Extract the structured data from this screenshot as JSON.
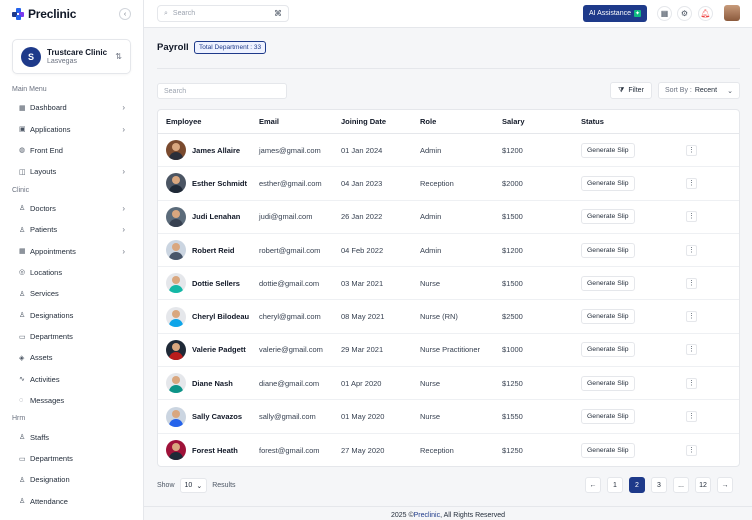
{
  "brand": {
    "name": "Preclinic"
  },
  "clinic": {
    "name": "Trustcare Clinic",
    "location": "Lasvegas",
    "initial": "S"
  },
  "sidebar": {
    "sections": [
      {
        "title": "Main Menu",
        "items": [
          {
            "label": "Dashboard",
            "icon": "grid-icon",
            "chevron": true
          },
          {
            "label": "Applications",
            "icon": "apps-icon",
            "chevron": true
          },
          {
            "label": "Front End",
            "icon": "globe-icon",
            "chevron": false
          },
          {
            "label": "Layouts",
            "icon": "layout-icon",
            "chevron": true
          }
        ]
      },
      {
        "title": "Clinic",
        "items": [
          {
            "label": "Doctors",
            "icon": "doctor-icon",
            "chevron": true
          },
          {
            "label": "Patients",
            "icon": "patient-icon",
            "chevron": true
          },
          {
            "label": "Appointments",
            "icon": "calendar-icon",
            "chevron": true
          },
          {
            "label": "Locations",
            "icon": "location-icon",
            "chevron": false
          },
          {
            "label": "Services",
            "icon": "services-icon",
            "chevron": false
          },
          {
            "label": "Designations",
            "icon": "designation-icon",
            "chevron": false
          },
          {
            "label": "Departments",
            "icon": "department-icon",
            "chevron": false
          },
          {
            "label": "Assets",
            "icon": "asset-icon",
            "chevron": false
          },
          {
            "label": "Activities",
            "icon": "activity-icon",
            "chevron": false
          },
          {
            "label": "Messages",
            "icon": "message-icon",
            "chevron": false
          }
        ]
      },
      {
        "title": "Hrm",
        "items": [
          {
            "label": "Staffs",
            "icon": "staff-icon",
            "chevron": false
          },
          {
            "label": "Departments",
            "icon": "department-icon",
            "chevron": false
          },
          {
            "label": "Designation",
            "icon": "designation-icon",
            "chevron": false
          },
          {
            "label": "Attendance",
            "icon": "attendance-icon",
            "chevron": false
          }
        ]
      }
    ]
  },
  "topbar": {
    "search_placeholder": "Search",
    "shortcut": "⌘",
    "ai_label": "AI Assistance"
  },
  "page": {
    "title": "Payroll",
    "badge": "Total Department : 33",
    "search_placeholder": "Search",
    "filter_label": "Filter",
    "sort_prefix": "Sort By :",
    "sort_value": "Recent"
  },
  "table": {
    "columns": [
      "Employee",
      "Email",
      "Joining Date",
      "Role",
      "Salary",
      "Status"
    ],
    "action_label": "Generate Slip",
    "rows": [
      {
        "name": "James Allaire",
        "email": "james@gmail.com",
        "joined": "01 Jan  2024",
        "role": "Admin",
        "salary": "$1200",
        "avatar_bg": "#7a4a2e",
        "shirt": "#2b2f3a"
      },
      {
        "name": "Esther Schmidt",
        "email": "esther@gmail.com",
        "joined": "04 Jan 2023",
        "role": "Reception",
        "salary": "$2000",
        "avatar_bg": "#4b5563",
        "shirt": "#1f2937"
      },
      {
        "name": "Judi Lenahan",
        "email": "judi@gmail.com",
        "joined": "26 Jan 2022",
        "role": "Admin",
        "salary": "$1500",
        "avatar_bg": "#5b6b7a",
        "shirt": "#374151"
      },
      {
        "name": "Robert Reid",
        "email": "robert@gmail.com",
        "joined": "04 Feb 2022",
        "role": "Admin",
        "salary": "$1200",
        "avatar_bg": "#cbd5e1",
        "shirt": "#475569"
      },
      {
        "name": "Dottie Sellers",
        "email": "dottie@gmail.com",
        "joined": "03 Mar 2021",
        "role": "Nurse",
        "salary": "$1500",
        "avatar_bg": "#e5e7eb",
        "shirt": "#14b8a6"
      },
      {
        "name": "Cheryl Bilodeau",
        "email": "cheryl@gmail.com",
        "joined": "08 May 2021",
        "role": "Nurse (RN)",
        "salary": "$2500",
        "avatar_bg": "#e5e7eb",
        "shirt": "#0ea5e9"
      },
      {
        "name": "Valerie Padgett",
        "email": "valerie@gmail.com",
        "joined": "29 Mar 2021",
        "role": "Nurse Practitioner",
        "salary": "$1000",
        "avatar_bg": "#1f2937",
        "shirt": "#b91c1c"
      },
      {
        "name": "Diane Nash",
        "email": "diane@gmail.com",
        "joined": "01 Apr 2020",
        "role": "Nurse",
        "salary": "$1250",
        "avatar_bg": "#e5e7eb",
        "shirt": "#0d9488"
      },
      {
        "name": "Sally Cavazos",
        "email": "sally@gmail.com",
        "joined": "01 May 2020",
        "role": "Nurse",
        "salary": "$1550",
        "avatar_bg": "#cbd5e1",
        "shirt": "#2563eb"
      },
      {
        "name": "Forest Heath",
        "email": "forest@gmail.com",
        "joined": "27 May 2020",
        "role": "Reception",
        "salary": "$1250",
        "avatar_bg": "#9f1239",
        "shirt": "#1f2937"
      }
    ]
  },
  "footer_controls": {
    "show_label": "Show",
    "show_value": "10",
    "results_label": "Results",
    "pages": [
      "1",
      "2",
      "3",
      "...",
      "12"
    ],
    "active_page": "2",
    "prev": "←",
    "next": "→"
  },
  "footer": {
    "text_before": "2025 © ",
    "brand": "Preclinic",
    "text_after": ", All Rights Reserved"
  },
  "colors": {
    "primary": "#1e3a8a",
    "accent": "#10b981",
    "logo_blue": "#2563eb",
    "logo_purple": "#7c3aed"
  }
}
